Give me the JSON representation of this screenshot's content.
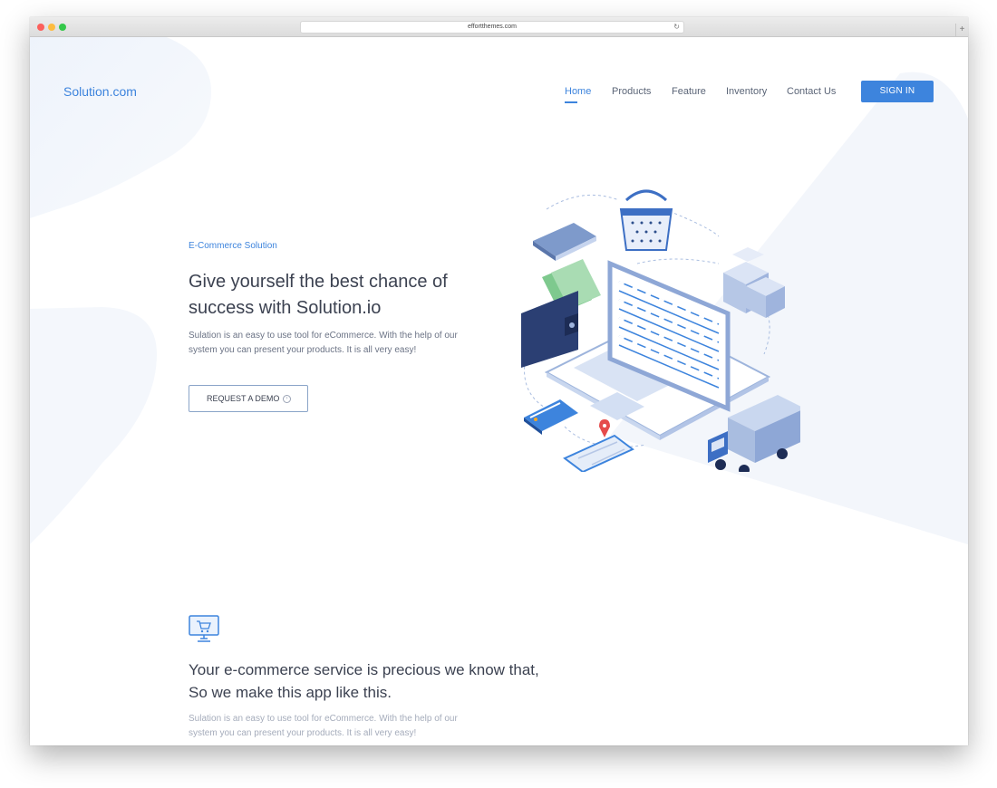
{
  "browser": {
    "url": "effortthemes.com",
    "reload_icon": "reload-icon",
    "new_tab_label": "+"
  },
  "header": {
    "logo": "Solution.com",
    "nav": [
      "Home",
      "Products",
      "Feature",
      "Inventory",
      "Contact Us"
    ],
    "active_nav": "Home",
    "signin_label": "SIGN IN"
  },
  "hero": {
    "eyebrow": "E-Commerce Solution",
    "title": "Give yourself the best chance of success with Solution.io",
    "description": "Sulation is an easy to use tool for eCommerce. With the help of our system you can present your products. It is all very easy!",
    "demo_label": "REQUEST A DEMO",
    "illustration": "isometric-ecommerce-illustration"
  },
  "feature": {
    "icon": "monitor-cart-icon",
    "title_line1": "Your e-commerce service is precious we know that,",
    "title_line2": "So we make this app like this.",
    "description": "Sulation is an easy to use tool for eCommerce. With the help of our system you can present your products. It is all very easy!"
  },
  "colors": {
    "accent": "#3d84dd",
    "heading": "#3c4251",
    "body_text": "#6b7385",
    "muted_text": "#a5acbb"
  }
}
